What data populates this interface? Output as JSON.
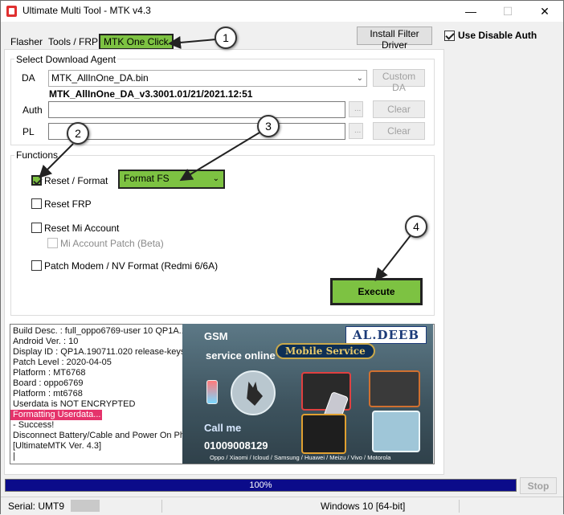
{
  "window": {
    "title": "Ultimate Multi Tool - MTK v4.3",
    "minimize": "—",
    "maximize": "☐",
    "close": "✕"
  },
  "tabs": [
    {
      "label": "Flasher"
    },
    {
      "label": "Tools / FRP"
    },
    {
      "label": "MTK One Click"
    }
  ],
  "header": {
    "install_filter_driver": "Install Filter Driver",
    "use_disable_auth": "Use Disable Auth"
  },
  "download_agent": {
    "title": "Select Download Agent",
    "da_label": "DA",
    "da_value": "MTK_AllInOne_DA.bin",
    "da_info": "MTK_AllInOne_DA_v3.3001.01/21/2021.12:51",
    "custom_da": "Custom DA",
    "auth_label": "Auth",
    "pl_label": "PL",
    "browse": "...",
    "clear": "Clear"
  },
  "functions": {
    "title": "Functions",
    "reset_format": "Reset / Format",
    "format_mode": "Format FS",
    "reset_frp": "Reset FRP",
    "reset_mi": "Reset Mi Account",
    "mi_patch": "Mi Account Patch (Beta)",
    "patch_modem": "Patch Modem / NV Format (Redmi 6/6A)",
    "execute": "Execute"
  },
  "log": [
    "Build Desc. : full_oppo6769-user 10 QP1A.190711.020 f8b77aba7cb33275 release-keys",
    "Android Ver. : 10",
    "Display ID : QP1A.190711.020 release-keys",
    "Patch Level : 2020-04-05",
    "Platform : MT6768",
    "Board : oppo6769",
    "Platform : mt6768",
    "Userdata is NOT ENCRYPTED",
    "Formatting Userdata...",
    "- Success!",
    "Disconnect Battery/Cable and Power On Phone.",
    "[UltimateMTK Ver. 4.3]"
  ],
  "ad": {
    "brand": "AL.DEEB",
    "gsm": "GSM",
    "service": "service online",
    "mobile_service": "Mobile Service",
    "call": "Call me",
    "phone": "01009008129",
    "brands": "Oppo / Xiaomi / Icloud / Samsung / Huawei / Meizu / Vivo / Motorola"
  },
  "callouts": [
    "1",
    "2",
    "3",
    "4"
  ],
  "progress": {
    "text": "100%",
    "value": 100
  },
  "stop": "Stop",
  "status": {
    "serial": "Serial: UMT9",
    "os": "Windows 10 [64-bit]"
  },
  "colors": {
    "highlight_green": "#7dc242",
    "progress_blue": "#0b0b8a",
    "log_highlight": "#e5336b"
  }
}
